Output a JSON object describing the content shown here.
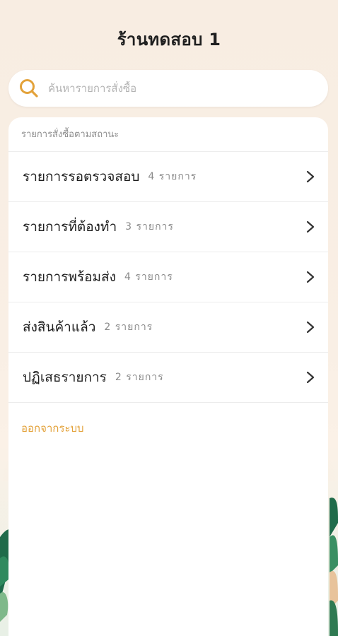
{
  "header": {
    "title": "ร้านทดสอบ 1"
  },
  "search": {
    "placeholder": "ค้นหารายการสั่งซื้อ",
    "value": ""
  },
  "orders": {
    "section_label": "รายการสั่งซื้อตามสถานะ",
    "items": [
      {
        "label": "รายการรอตรวจสอบ",
        "count": "4 รายการ"
      },
      {
        "label": "รายการที่ต้องทำ",
        "count": "3 รายการ"
      },
      {
        "label": "รายการพร้อมส่ง",
        "count": "4 รายการ"
      },
      {
        "label": "ส่งสินค้าแล้ว",
        "count": "2 รายการ"
      },
      {
        "label": "ปฏิเสธรายการ",
        "count": "2 รายการ"
      }
    ],
    "logout_label": "ออกจากระบบ"
  },
  "theme": {
    "accent": "#e3a23a",
    "background": "#f8ede2",
    "leaf_dark": "#1f6b4a",
    "leaf_light": "#7fb98a"
  }
}
